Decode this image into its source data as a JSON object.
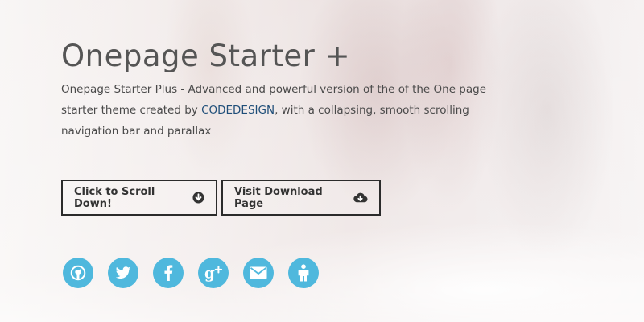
{
  "hero": {
    "title": "Onepage Starter +",
    "description_before": "Onepage Starter Plus - Advanced and powerful version of the of the One page starter theme created by ",
    "description_link": "CODEDESIGN",
    "description_after": ", with a collapsing, smooth scrolling navigation bar and parallax"
  },
  "buttons": {
    "scroll_label": "Click to Scroll Down!",
    "scroll_icon": "arrow-circle-down-icon",
    "download_label": "Visit Download Page",
    "download_icon": "cloud-download-icon"
  },
  "socials": [
    {
      "icon": "github-icon"
    },
    {
      "icon": "twitter-icon"
    },
    {
      "icon": "facebook-icon"
    },
    {
      "icon": "google-plus-icon"
    },
    {
      "icon": "email-icon"
    },
    {
      "icon": "user-icon"
    }
  ],
  "colors": {
    "social_bg": "#4fb8dd",
    "link": "#1f4e79",
    "text": "#4a4a4a",
    "button_border": "#2b2b2b"
  }
}
